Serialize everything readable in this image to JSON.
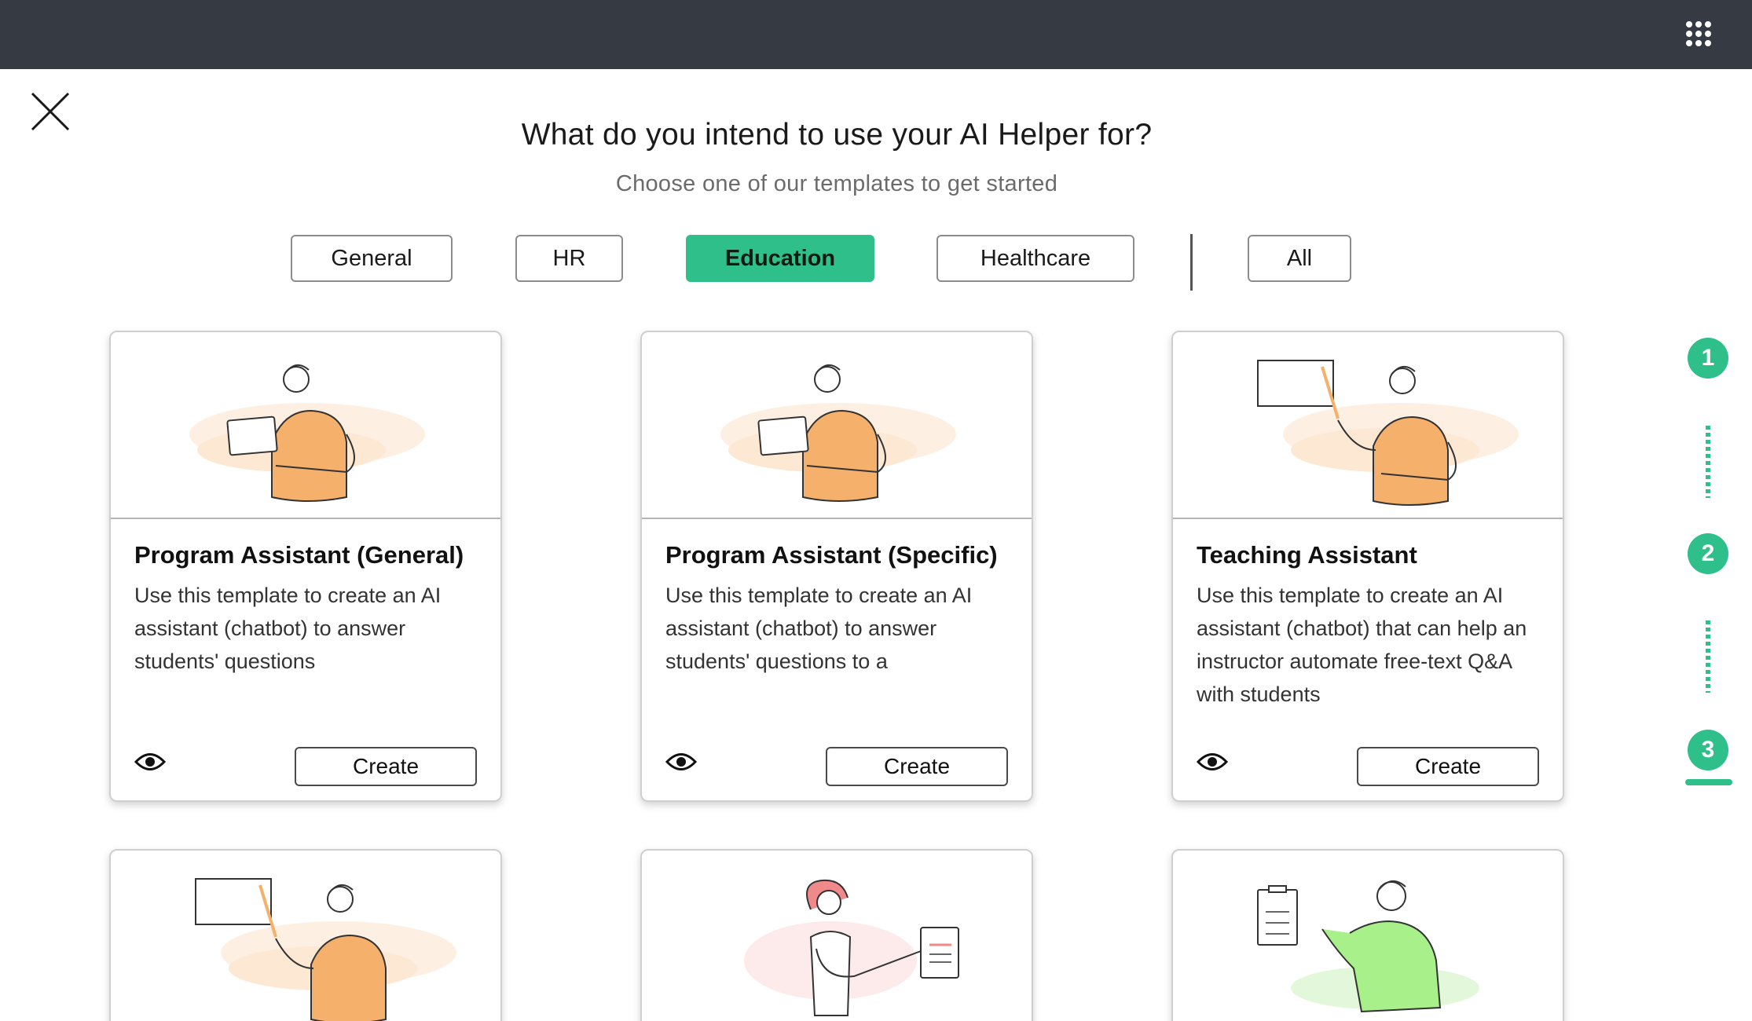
{
  "header": {
    "apps_icon": "apps-grid-icon"
  },
  "close_icon": "close-icon",
  "title": "What do you intend to use your AI Helper for?",
  "subtitle": "Choose one of our templates to get started",
  "filters": [
    {
      "label": "General",
      "active": false
    },
    {
      "label": "HR",
      "active": false
    },
    {
      "label": "Education",
      "active": true
    },
    {
      "label": "Healthcare",
      "active": false
    },
    {
      "label": "All",
      "active": false
    }
  ],
  "colors": {
    "accent": "#2fbf8a",
    "topbar": "#363a42",
    "illustration_orange": "#f5b06b",
    "illustration_green": "#a8f08a",
    "illustration_pink": "#f08a8a"
  },
  "cards": [
    {
      "title": "Program Assistant (General)",
      "description": "Use this template to create an AI assistant (chatbot) to answer students' questions",
      "preview_icon": "eye-icon",
      "create_label": "Create"
    },
    {
      "title": "Program Assistant (Specific)",
      "description": "Use this template to create an AI assistant (chatbot) to answer students' questions to a",
      "preview_icon": "eye-icon",
      "create_label": "Create"
    },
    {
      "title": "Teaching Assistant",
      "description": "Use this template to create an AI assistant (chatbot) that can help an instructor automate free-text Q&A with students",
      "preview_icon": "eye-icon",
      "create_label": "Create"
    }
  ],
  "steps": [
    "1",
    "2",
    "3"
  ]
}
